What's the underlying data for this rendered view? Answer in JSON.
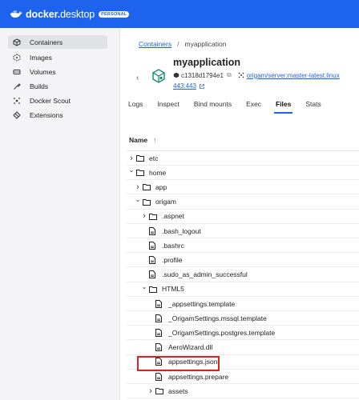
{
  "app": {
    "brand_bold": "docker",
    "brand_light": "desktop",
    "badge": "PERSONAL"
  },
  "sidebar": {
    "items": [
      {
        "label": "Containers",
        "icon": "container-icon",
        "active": true
      },
      {
        "label": "Images",
        "icon": "images-icon",
        "active": false
      },
      {
        "label": "Volumes",
        "icon": "volumes-icon",
        "active": false
      },
      {
        "label": "Builds",
        "icon": "builds-icon",
        "active": false
      },
      {
        "label": "Docker Scout",
        "icon": "scout-icon",
        "active": false
      },
      {
        "label": "Extensions",
        "icon": "extensions-icon",
        "active": false
      }
    ]
  },
  "breadcrumb": {
    "parent": "Containers",
    "sep": "/",
    "current": "myapplication"
  },
  "container": {
    "name": "myapplication",
    "id": "c1318d1794e1",
    "image": "origam/server:master-latest.linux",
    "ports": "443:443"
  },
  "tabs": [
    {
      "label": "Logs",
      "active": false
    },
    {
      "label": "Inspect",
      "active": false
    },
    {
      "label": "Bind mounts",
      "active": false
    },
    {
      "label": "Exec",
      "active": false
    },
    {
      "label": "Files",
      "active": true
    },
    {
      "label": "Stats",
      "active": false
    }
  ],
  "files": {
    "header": "Name",
    "sort_icon": "sort-up-arrow",
    "rows": [
      {
        "name": "etc",
        "type": "folder",
        "expanded": false,
        "depth": 0
      },
      {
        "name": "home",
        "type": "folder",
        "expanded": true,
        "depth": 0
      },
      {
        "name": "app",
        "type": "folder",
        "expanded": false,
        "depth": 1
      },
      {
        "name": "origam",
        "type": "folder",
        "expanded": true,
        "depth": 1
      },
      {
        "name": ".aspnet",
        "type": "folder",
        "expanded": false,
        "depth": 2
      },
      {
        "name": ".bash_logout",
        "type": "file",
        "depth": 2
      },
      {
        "name": ".bashrc",
        "type": "file",
        "depth": 2
      },
      {
        "name": ".profile",
        "type": "file",
        "depth": 2
      },
      {
        "name": ".sudo_as_admin_successful",
        "type": "file",
        "depth": 2
      },
      {
        "name": "HTML5",
        "type": "folder",
        "expanded": true,
        "depth": 2
      },
      {
        "name": "_appsettings.template",
        "type": "file",
        "depth": 3
      },
      {
        "name": "_OrigamSettings.mssql.template",
        "type": "file",
        "depth": 3
      },
      {
        "name": "_OrigamSettings.postgres.template",
        "type": "file",
        "depth": 3
      },
      {
        "name": "AeroWizard.dll",
        "type": "file",
        "depth": 3
      },
      {
        "name": "appsettings.json",
        "type": "file",
        "depth": 3,
        "highlighted": true
      },
      {
        "name": "appsettings.prepare",
        "type": "file",
        "depth": 3
      },
      {
        "name": "assets",
        "type": "folder",
        "expanded": false,
        "depth": 3
      }
    ]
  },
  "colors": {
    "accent": "#1d63ed",
    "highlight": "#e0201b",
    "sidebar_bg": "#f4f4f6"
  }
}
